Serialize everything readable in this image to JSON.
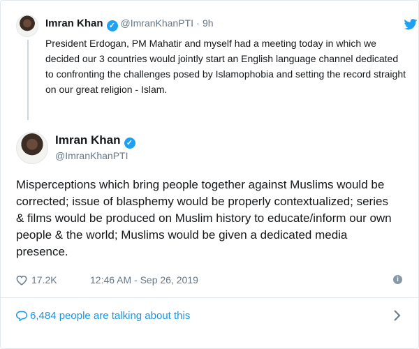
{
  "parent_tweet": {
    "name": "Imran Khan",
    "handle": "@ImranKhanPTI",
    "separator": "·",
    "time": "9h",
    "text": "President Erdogan, PM Mahatir and myself had a meeting today in which we decided our 3 countries would jointly start an English language channel dedicated to confronting the challenges posed by Islamophobia and setting the record straight on our great religion - Islam."
  },
  "main_tweet": {
    "name": "Imran Khan",
    "handle": "@ImranKhanPTI",
    "text": "Misperceptions which bring people together against Muslims would be corrected; issue of blasphemy would be properly contextualized; series & films would be produced on Muslim history to educate/inform our own people & the world; Muslims would be given a dedicated media presence.",
    "likes": "17.2K",
    "timestamp": "12:46 AM - Sep 26, 2019"
  },
  "footer": {
    "talking": "6,484 people are talking about this"
  },
  "icons": {
    "verified": "verified-badge-icon",
    "brand": "twitter-bird-icon",
    "like": "heart-icon",
    "info": "info-icon",
    "reply": "speech-bubble-icon",
    "more": "chevron-right-icon"
  },
  "colors": {
    "accent": "#1da1f2",
    "link": "#1b95e0",
    "muted": "#657786"
  }
}
